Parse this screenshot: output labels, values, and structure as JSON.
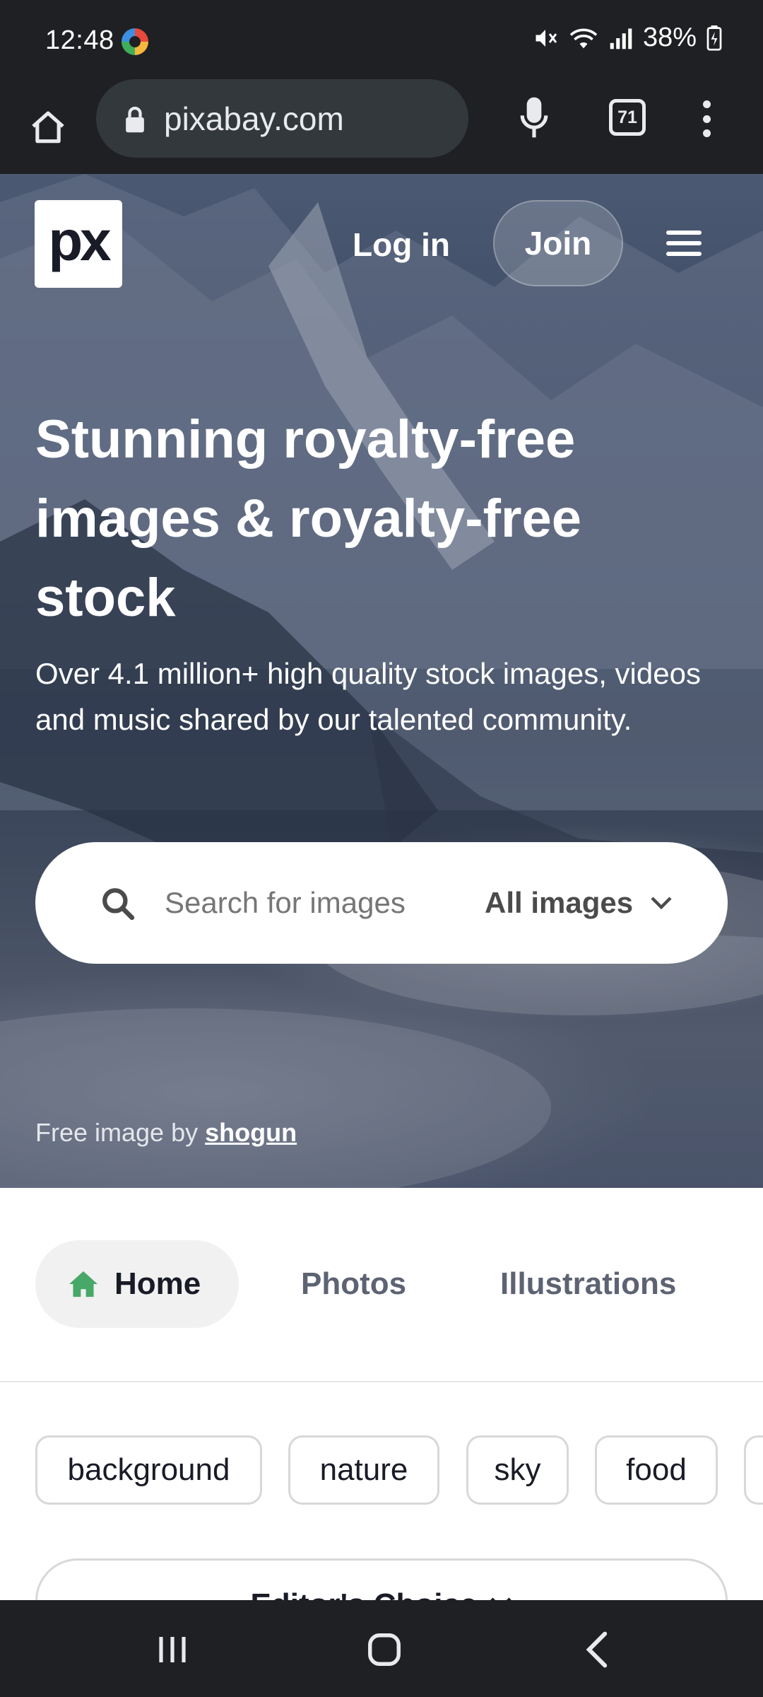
{
  "status_bar": {
    "time": "12:48",
    "battery": "38%",
    "icons": [
      "app-notification-icon",
      "mute-icon",
      "wifi-icon",
      "signal-icon",
      "battery-icon"
    ]
  },
  "browser": {
    "url": "pixabay.com",
    "tab_count": "71",
    "icons": [
      "home-icon",
      "lock-icon",
      "mic-icon",
      "tabs-icon",
      "more-vert-icon"
    ]
  },
  "header": {
    "logo_text": "px",
    "login_label": "Log in",
    "join_label": "Join"
  },
  "hero": {
    "title": "Stunning royalty-free images & royalty-free stock",
    "subtitle": "Over 4.1 million+ high quality stock images, videos and music shared by our talented community.",
    "credit_prefix": "Free image by ",
    "credit_author": "shogun"
  },
  "search": {
    "placeholder": "Search for images",
    "value": "",
    "type_label": "All images"
  },
  "nav_tabs": [
    {
      "label": "Home",
      "active": true
    },
    {
      "label": "Photos",
      "active": false
    },
    {
      "label": "Illustrations",
      "active": false
    }
  ],
  "tags": [
    "background",
    "nature",
    "sky",
    "food",
    ""
  ],
  "editors_choice_label": "Editor's Choice",
  "colors": {
    "chrome_dark": "#1f2023",
    "url_pill": "#33383c",
    "home_icon_green": "#48a868",
    "text_dark": "#191b26",
    "text_muted": "#5d6373"
  }
}
